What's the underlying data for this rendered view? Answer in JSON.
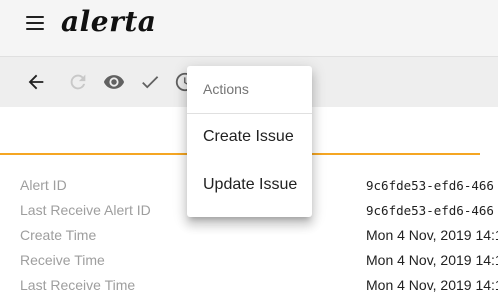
{
  "app": {
    "logo": "alerta"
  },
  "toolbar": {
    "icons": [
      "back-arrow-icon",
      "refresh-icon",
      "eye-icon",
      "check-icon",
      "clock-icon"
    ]
  },
  "menu": {
    "header": "Actions",
    "items": [
      {
        "label": "Create Issue"
      },
      {
        "label": "Update Issue"
      }
    ]
  },
  "details": {
    "rows": [
      {
        "label": "Alert ID",
        "value": "9c6fde53-efd6-466"
      },
      {
        "label": "Last Receive Alert ID",
        "value": "9c6fde53-efd6-466"
      },
      {
        "label": "Create Time",
        "value": "Mon 4 Nov, 2019 14:1"
      },
      {
        "label": "Receive Time",
        "value": "Mon 4 Nov, 2019 14:1"
      },
      {
        "label": "Last Receive Time",
        "value": "Mon 4 Nov, 2019 14:1"
      }
    ]
  },
  "colors": {
    "accent": "#f5a623",
    "appbar": "#f5f5f5",
    "toolbar": "#eeeeee"
  }
}
